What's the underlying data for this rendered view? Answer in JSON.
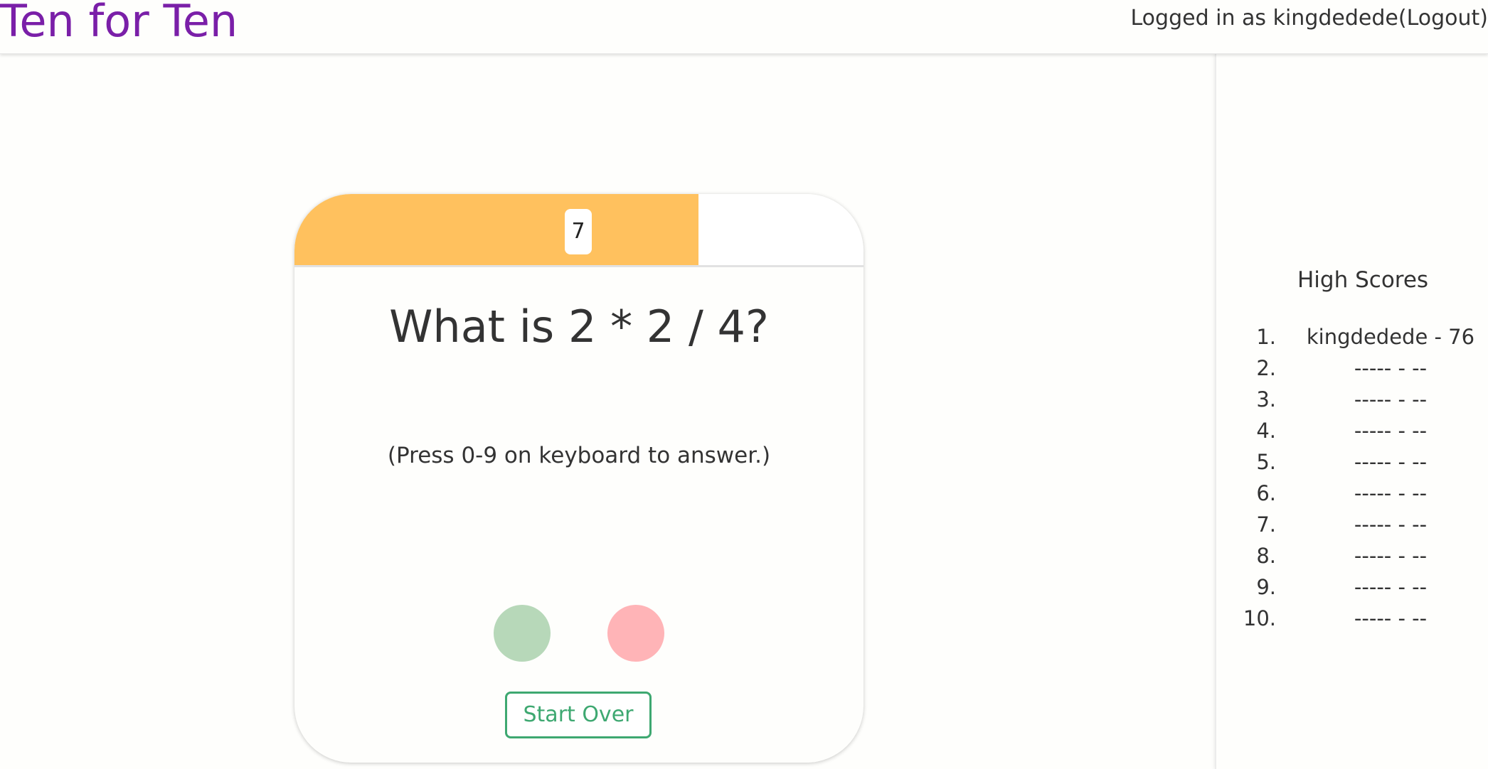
{
  "header": {
    "title": "Ten for Ten",
    "logged_in_label": "Logged in as kingdedede",
    "logout_label": "(Logout)"
  },
  "game": {
    "timer_value": "7",
    "timer_fraction": 0.71,
    "question": "What is 2 * 2 / 4?",
    "instruction": "(Press 0-9 on keyboard to answer.)",
    "start_over_label": "Start Over"
  },
  "high_scores": {
    "title": "High Scores",
    "entries": [
      {
        "rank": "1.",
        "text": "kingdedede - 76"
      },
      {
        "rank": "2.",
        "text": "----- - --"
      },
      {
        "rank": "3.",
        "text": "----- - --"
      },
      {
        "rank": "4.",
        "text": "----- - --"
      },
      {
        "rank": "5.",
        "text": "----- - --"
      },
      {
        "rank": "6.",
        "text": "----- - --"
      },
      {
        "rank": "7.",
        "text": "----- - --"
      },
      {
        "rank": "8.",
        "text": "----- - --"
      },
      {
        "rank": "9.",
        "text": "----- - --"
      },
      {
        "rank": "10.",
        "text": "----- - --"
      }
    ]
  },
  "colors": {
    "brand": "#7a1fa8",
    "timer": "#ffc15e",
    "correct": "#b7d8b9",
    "wrong": "#ffb4b7",
    "button": "#3ea871"
  }
}
